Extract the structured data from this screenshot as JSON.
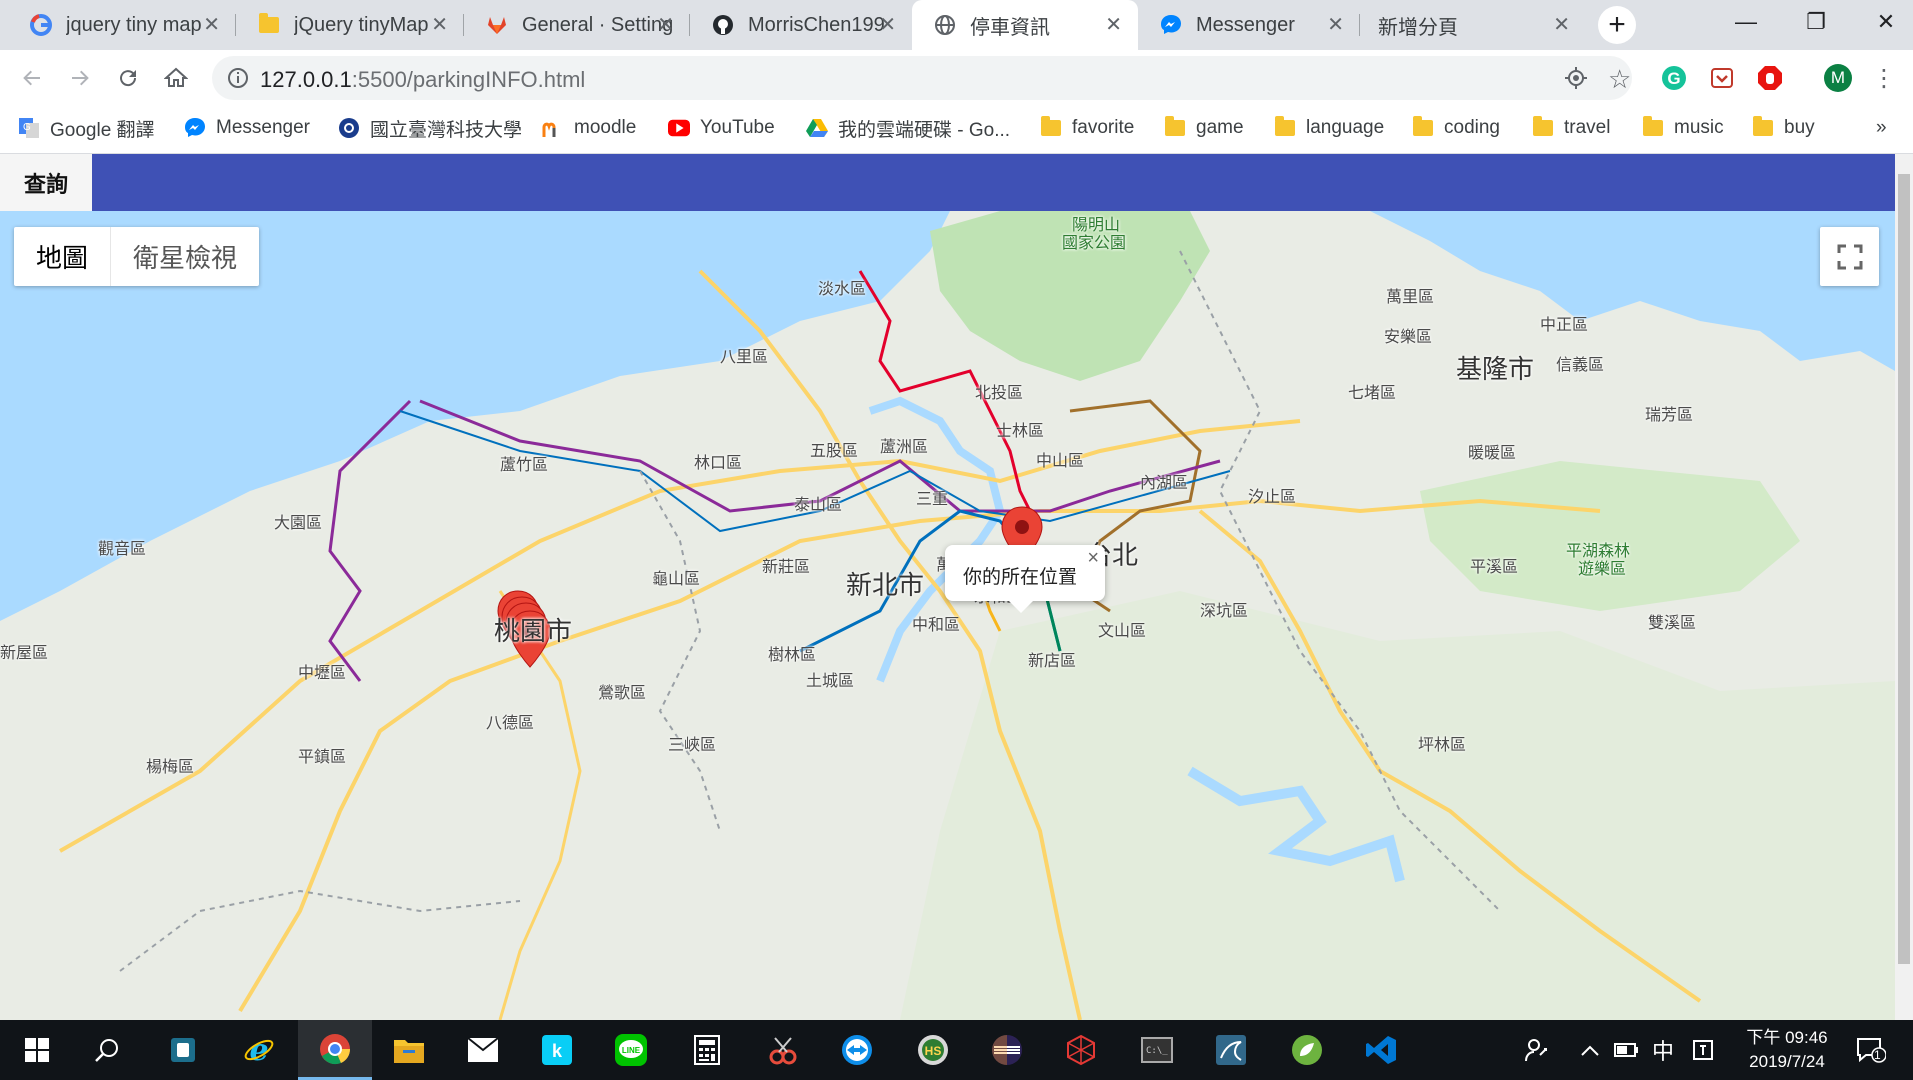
{
  "browser": {
    "tabs": [
      {
        "title": "jquery tiny map",
        "icon": "google-icon"
      },
      {
        "title": "jQuery tinyMap",
        "icon": "folder-icon"
      },
      {
        "title": "General · Setting",
        "icon": "gitlab-icon"
      },
      {
        "title": "MorrisChen199",
        "icon": "github-icon"
      },
      {
        "title": "停車資訊",
        "icon": "globe-icon",
        "active": true
      },
      {
        "title": "Messenger",
        "icon": "messenger-icon"
      },
      {
        "title": "新增分頁",
        "icon": ""
      }
    ],
    "url_host": "127.0.0.1",
    "url_rest": ":5500/parkingINFO.html",
    "profile_initial": "M",
    "bookmarks": [
      {
        "label": "Google 翻譯",
        "icon": "google-translate-icon"
      },
      {
        "label": "Messenger",
        "icon": "messenger-icon"
      },
      {
        "label": "國立臺灣科技大學",
        "icon": "ntust-icon"
      },
      {
        "label": "moodle",
        "icon": "moodle-icon"
      },
      {
        "label": "YouTube",
        "icon": "youtube-icon"
      },
      {
        "label": "我的雲端硬碟 - Go...",
        "icon": "drive-icon"
      },
      {
        "label": "favorite",
        "icon": "folder-icon"
      },
      {
        "label": "game",
        "icon": "folder-icon"
      },
      {
        "label": "language",
        "icon": "folder-icon"
      },
      {
        "label": "coding",
        "icon": "folder-icon"
      },
      {
        "label": "travel",
        "icon": "folder-icon"
      },
      {
        "label": "music",
        "icon": "folder-icon"
      },
      {
        "label": "buy",
        "icon": "folder-icon"
      }
    ],
    "bookmarks_overflow": "»"
  },
  "page": {
    "query_button": "查詢",
    "map_type": {
      "map": "地圖",
      "satellite": "衛星檢視"
    },
    "info_window": "你的所在位置",
    "info_close": "×",
    "labels": [
      {
        "text": "陽明山",
        "kind": "park"
      },
      {
        "text": "國家公園",
        "kind": "park"
      },
      {
        "text": "淡水區"
      },
      {
        "text": "萬里區"
      },
      {
        "text": "八里區"
      },
      {
        "text": "安樂區"
      },
      {
        "text": "中正區"
      },
      {
        "text": "基隆市",
        "kind": "big"
      },
      {
        "text": "信義區"
      },
      {
        "text": "北投區"
      },
      {
        "text": "七堵區"
      },
      {
        "text": "瑞芳區"
      },
      {
        "text": "士林區"
      },
      {
        "text": "蘆竹區"
      },
      {
        "text": "林口區"
      },
      {
        "text": "五股區"
      },
      {
        "text": "蘆洲區"
      },
      {
        "text": "中山區"
      },
      {
        "text": "內湖區"
      },
      {
        "text": "暖暖區"
      },
      {
        "text": "大園區"
      },
      {
        "text": "泰山區"
      },
      {
        "text": "三重"
      },
      {
        "text": "汐止區"
      },
      {
        "text": "觀音區"
      },
      {
        "text": "新莊區"
      },
      {
        "text": "萬華區"
      },
      {
        "text": "台北",
        "kind": "big"
      },
      {
        "text": "平溪區"
      },
      {
        "text": "平湖森林",
        "kind": "park"
      },
      {
        "text": "遊樂區",
        "kind": "park"
      },
      {
        "text": "龜山區"
      },
      {
        "text": "新北市",
        "kind": "big"
      },
      {
        "text": "永和區"
      },
      {
        "text": "桃園市",
        "kind": "big"
      },
      {
        "text": "中和區"
      },
      {
        "text": "文山區"
      },
      {
        "text": "深坑區"
      },
      {
        "text": "雙溪區"
      },
      {
        "text": "新屋區"
      },
      {
        "text": "樹林區"
      },
      {
        "text": "新店區"
      },
      {
        "text": "中壢區"
      },
      {
        "text": "土城區"
      },
      {
        "text": "鶯歌區"
      },
      {
        "text": "八德區"
      },
      {
        "text": "三峽區"
      },
      {
        "text": "坪林區"
      },
      {
        "text": "楊梅區"
      },
      {
        "text": "平鎮區"
      }
    ]
  },
  "taskbar": {
    "apps": [
      "windows-start-icon",
      "search-icon",
      "store-icon",
      "ie-icon",
      "chrome-icon",
      "file-explorer-icon",
      "mail-icon",
      "kkbox-icon",
      "line-icon",
      "calculator-icon",
      "snipping-icon",
      "teamviewer-icon",
      "hs-icon",
      "eclipse-icon",
      "network-icon",
      "cmd-icon",
      "mysql-icon",
      "spring-icon",
      "vscode-icon"
    ],
    "ime": "中",
    "time": "下午 09:46",
    "date": "2019/7/24",
    "notifications": "1"
  },
  "colors": {
    "appbar": "#3f51b5",
    "marker": "#ea4335",
    "tabstrip": "#dee1e6"
  }
}
